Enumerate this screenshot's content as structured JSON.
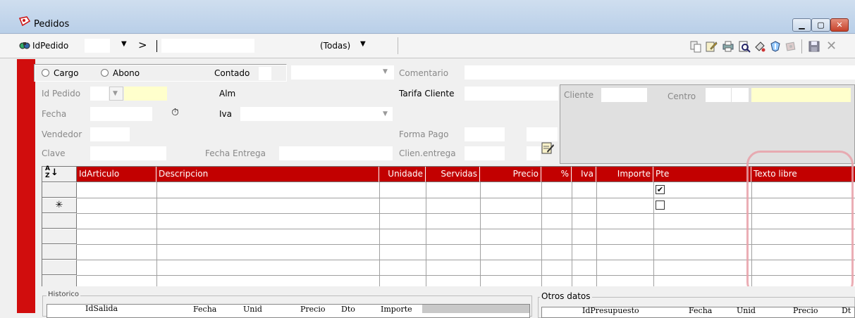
{
  "window": {
    "title": "Pedidos",
    "controls": {
      "min": "▁",
      "max": "▢",
      "close": "✕"
    }
  },
  "navbar": {
    "field_label": "IdPedido",
    "combo_arrow": "▼",
    "next_label": ">",
    "filter_value": "(Todas)",
    "filter_arrow": "▼",
    "toolbar_icons": [
      "copy-icon",
      "edit-note-icon",
      "print-icon",
      "preview-icon",
      "paint-icon",
      "shield-icon",
      "money-icon",
      "save-icon",
      "cancel-icon"
    ],
    "cancel_glyph": "✕"
  },
  "form": {
    "cargo_label": "Cargo",
    "abono_label": "Abono",
    "contado_label": "Contado",
    "comentario_label": "Comentario",
    "id_pedido_label": "Id Pedido",
    "alm_label": "Alm",
    "tarifa_cliente_label": "Tarifa Cliente",
    "cliente_label": "Cliente",
    "centro_label": "Centro",
    "fecha_label": "Fecha",
    "iva_label": "Iva",
    "vendedor_label": "Vendedor",
    "forma_pago_label": "Forma Pago",
    "clave_label": "Clave",
    "fecha_entrega_label": "Fecha Entrega",
    "clien_entrega_label": "Clien.entrega",
    "dropdown_arrow": "▼",
    "clock_glyph": "⏱"
  },
  "grid": {
    "sort_glyph": "↓",
    "sort_top": "A",
    "sort_bottom": "Z",
    "columns": [
      "IdArticulo",
      "Descripcion",
      "Unidade",
      "Servidas",
      "Precio",
      "%",
      "Iva",
      "Importe",
      "Pte",
      "Texto libre"
    ],
    "new_row_marker": "✳",
    "rows": [
      {
        "pte_checked": true
      },
      {
        "pte_checked": false
      }
    ],
    "check_glyph": "✔"
  },
  "historico": {
    "legend": "Historico",
    "columns": [
      "IdSalida",
      "Fecha",
      "Unid",
      "Precio",
      "Dto",
      "Importe"
    ]
  },
  "otros": {
    "legend": "Otros datos",
    "columns": [
      "IdPresupuesto",
      "Fecha",
      "Unid",
      "Precio",
      "Dt"
    ]
  },
  "colors": {
    "accent_red": "#c20000",
    "strip_red": "#d10d0d",
    "highlight": "#e8a0a8",
    "yellow_field": "#ffffcc"
  }
}
